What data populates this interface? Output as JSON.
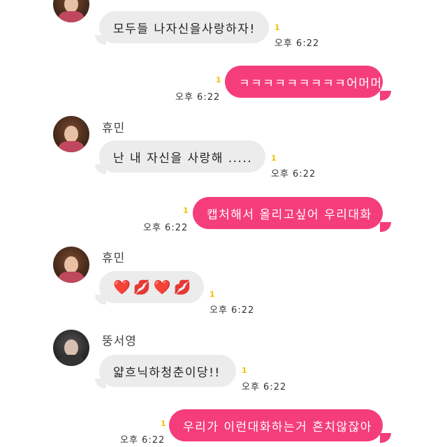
{
  "messages": [
    {
      "sender": "",
      "text": "모두들 나자신을사랑하자!",
      "time": "오후 6:22",
      "unread": "1"
    },
    {
      "text": "ㅋㅋㅋㅋㅋㅋㅋㅋㅋ어머머",
      "time": "오후 6:22",
      "unread": "1"
    },
    {
      "sender": "휴민",
      "text": "난 내 자신을 사랑해 .....",
      "time": "오후 6:22",
      "unread": "1"
    },
    {
      "text": "캡처해서 올리고싶어 우리대화",
      "time": "오후 6:22",
      "unread": "1"
    },
    {
      "sender": "휴민",
      "text": "❤️💋❤️💋",
      "time": "오후 6:22",
      "unread": "1"
    },
    {
      "sender": "뚱서영",
      "text": "얇흐닉하청춘이당!!",
      "time": "오후 6:22",
      "unread": "1"
    },
    {
      "text": "우리가 이런대화하는거 흔치않잖아",
      "time": "오후 6:22",
      "unread": "1"
    }
  ],
  "colors": {
    "outgoing": "#f53d7b",
    "incoming": "#ececec",
    "unread": "#f2c200"
  }
}
